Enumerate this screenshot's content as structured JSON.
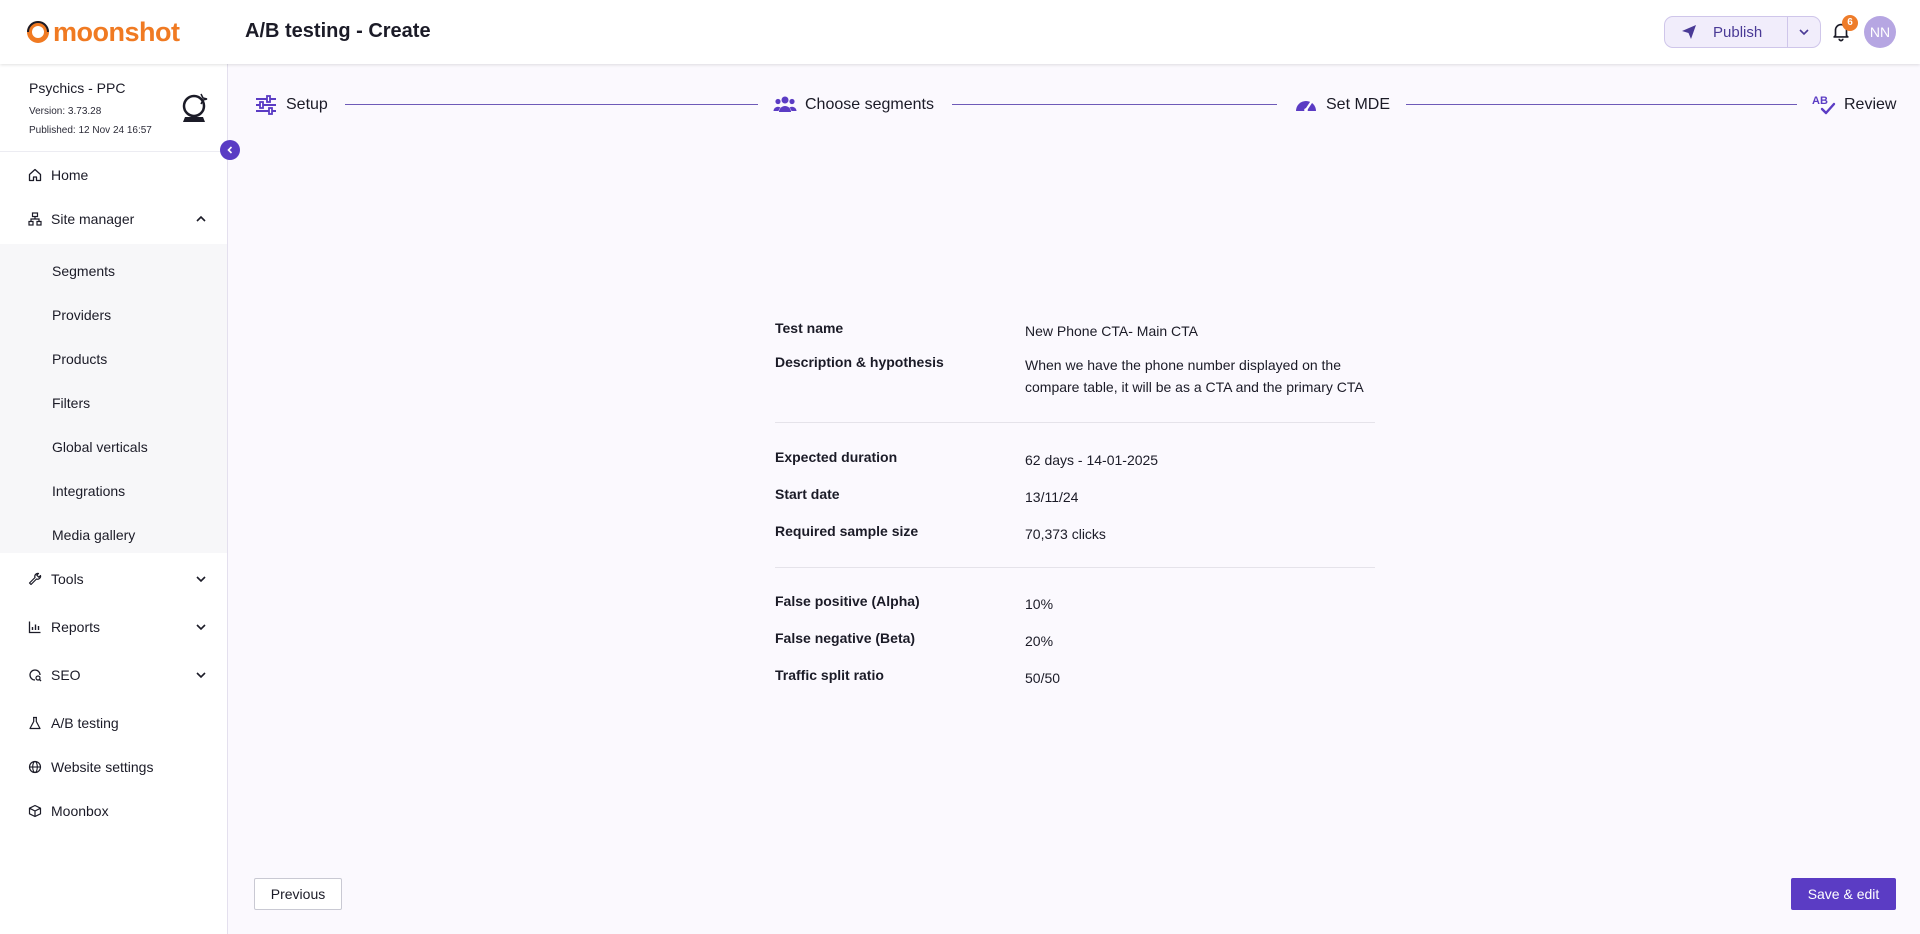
{
  "app": {
    "brand": "moonshot",
    "page_title": "A/B testing - Create"
  },
  "header": {
    "publish_label": "Publish",
    "notification_count": "6",
    "avatar_initials": "NN"
  },
  "site": {
    "name": "Psychics - PPC",
    "version": "Version: 3.73.28",
    "published": "Published: 12 Nov 24 16:57"
  },
  "sidebar": {
    "items": [
      {
        "label": "Home",
        "icon": "home-icon"
      },
      {
        "label": "Site manager",
        "icon": "sitemap-icon",
        "expanded": true
      },
      {
        "label": "Tools",
        "icon": "wrench-icon"
      },
      {
        "label": "Reports",
        "icon": "chart-icon"
      },
      {
        "label": "SEO",
        "icon": "seo-icon"
      },
      {
        "label": "A/B testing",
        "icon": "flask-icon"
      },
      {
        "label": "Website settings",
        "icon": "globe-icon"
      },
      {
        "label": "Moonbox",
        "icon": "cube-icon"
      }
    ],
    "site_manager_children": [
      "Segments",
      "Providers",
      "Products",
      "Filters",
      "Global verticals",
      "Integrations",
      "Media gallery"
    ]
  },
  "stepper": {
    "steps": [
      "Setup",
      "Choose segments",
      "Set MDE",
      "Review"
    ],
    "accent": "#5b3cc4"
  },
  "review": {
    "test_name": {
      "label": "Test name",
      "value": "New Phone CTA- Main CTA"
    },
    "description": {
      "label": "Description & hypothesis",
      "value": "When we have the phone number displayed on the compare table, it will be as a CTA and the primary CTA"
    },
    "expected_duration": {
      "label": "Expected duration",
      "value": "62 days - 14-01-2025"
    },
    "start_date": {
      "label": "Start date",
      "value": "13/11/24"
    },
    "sample_size": {
      "label": "Required sample size",
      "value": "70,373 clicks"
    },
    "alpha": {
      "label": "False positive (Alpha)",
      "value": "10%"
    },
    "beta": {
      "label": "False negative (Beta)",
      "value": "20%"
    },
    "split": {
      "label": "Traffic split ratio",
      "value": "50/50"
    }
  },
  "footer": {
    "previous_label": "Previous",
    "save_label": "Save & edit"
  }
}
